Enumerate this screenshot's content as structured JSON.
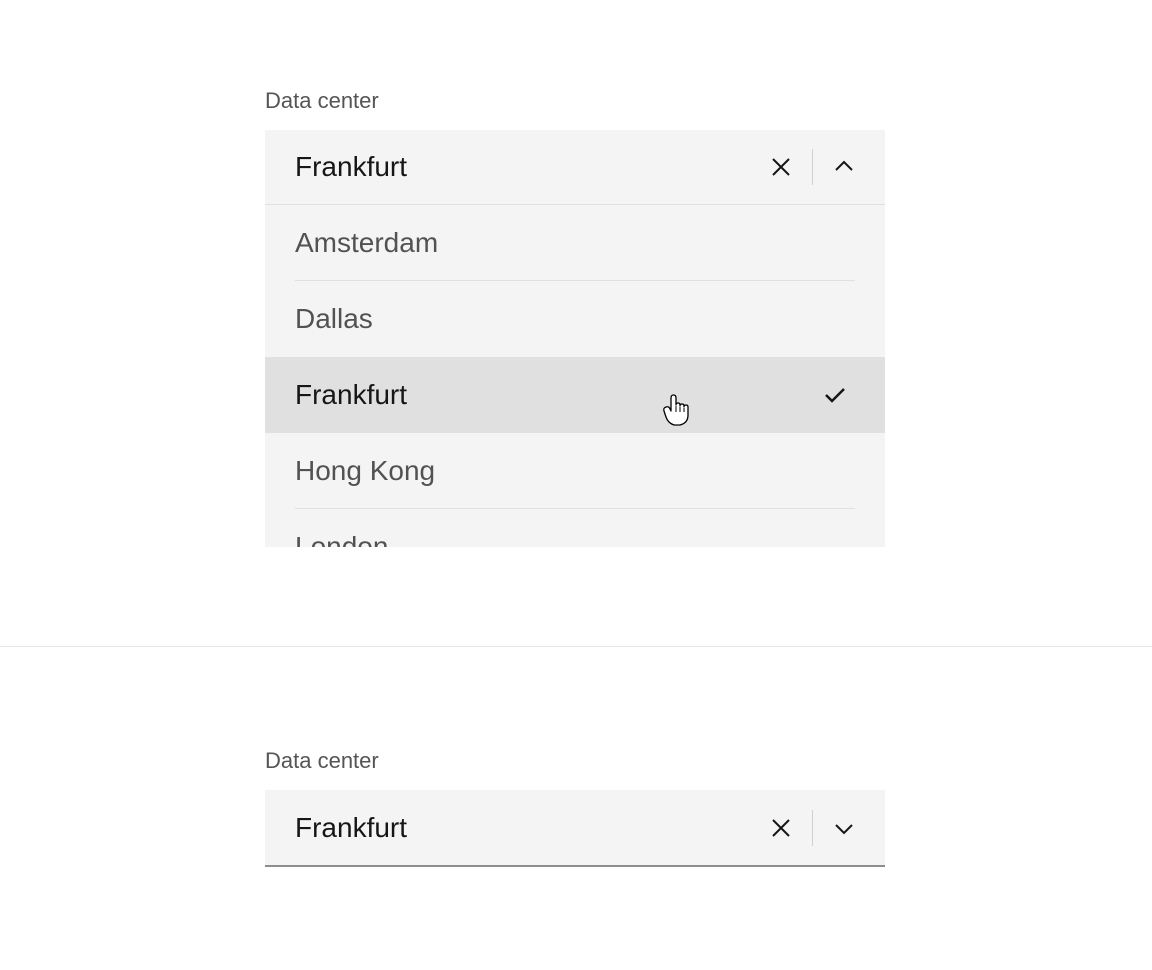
{
  "top": {
    "label": "Data center",
    "value": "Frankfurt",
    "options": [
      {
        "label": "Amsterdam",
        "selected": false
      },
      {
        "label": "Dallas",
        "selected": false
      },
      {
        "label": "Frankfurt",
        "selected": true
      },
      {
        "label": "Hong Kong",
        "selected": false
      },
      {
        "label": "London",
        "selected": false
      }
    ]
  },
  "bottom": {
    "label": "Data center",
    "value": "Frankfurt"
  }
}
